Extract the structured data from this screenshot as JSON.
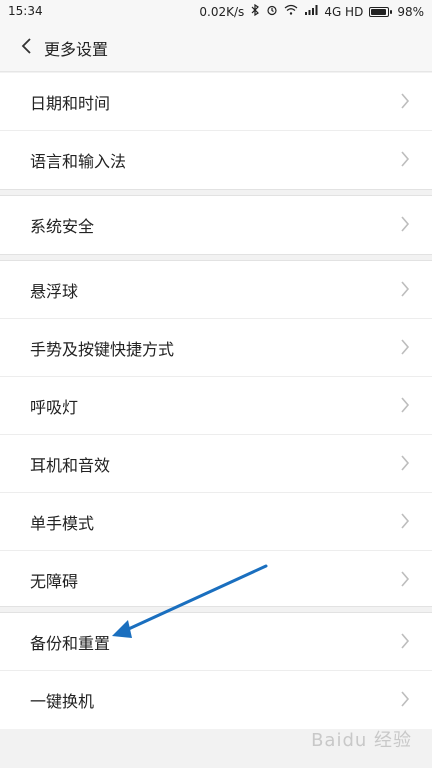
{
  "status_bar": {
    "time": "15:34",
    "speed": "0.02K/s",
    "network": "4G HD",
    "battery_percent": "98%",
    "battery_level": 0.98,
    "icons": [
      "bluetooth-icon",
      "alarm-icon",
      "wifi-icon",
      "signal-icon",
      "battery-icon"
    ]
  },
  "header": {
    "title": "更多设置",
    "back_icon": "chevron-left-icon"
  },
  "sections": [
    {
      "items": [
        {
          "label": "日期和时间"
        },
        {
          "label": "语言和输入法"
        }
      ]
    },
    {
      "items": [
        {
          "label": "系统安全"
        }
      ]
    },
    {
      "items": [
        {
          "label": "悬浮球"
        },
        {
          "label": "手势及按键快捷方式"
        },
        {
          "label": "呼吸灯"
        },
        {
          "label": "耳机和音效"
        },
        {
          "label": "单手模式"
        },
        {
          "label": "无障碍"
        }
      ]
    },
    {
      "items": [
        {
          "label": "备份和重置"
        },
        {
          "label": "一键换机"
        }
      ]
    }
  ],
  "annotation": {
    "arrow_color": "#1a6fbf",
    "points_to": "备份和重置"
  },
  "watermark": "Baidu 经验",
  "colors": {
    "background": "#f2f2f2",
    "row_background": "#ffffff",
    "chevron": "#bdbdbd",
    "text": "#222222"
  }
}
